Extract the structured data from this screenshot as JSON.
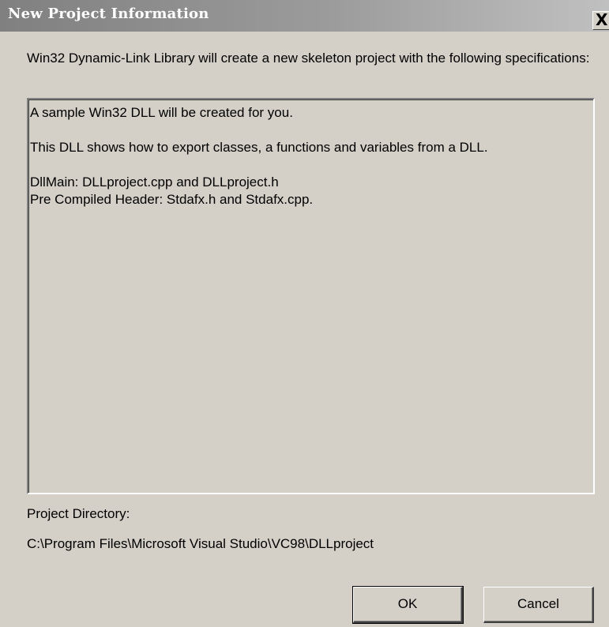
{
  "window": {
    "title": "New Project Information",
    "close_glyph": "X"
  },
  "intro": "Win32 Dynamic-Link Library will create a new skeleton project with the following specifications:",
  "specifications": {
    "lines": [
      "A sample Win32 DLL will be created for you.",
      "This DLL shows how to export classes, a functions and variables from a DLL.",
      "DllMain: DLLproject.cpp and DLLproject.h",
      "Pre Compiled Header: Stdafx.h and Stdafx.cpp."
    ]
  },
  "project_directory": {
    "label": "Project Directory:",
    "value": "C:\\Program Files\\Microsoft Visual Studio\\VC98\\DLLproject"
  },
  "buttons": {
    "ok": "OK",
    "cancel": "Cancel"
  },
  "colors": {
    "dialog_face": "#d4d0c8",
    "title_bar_inactive": "#808080",
    "title_text": "#ffffff"
  }
}
